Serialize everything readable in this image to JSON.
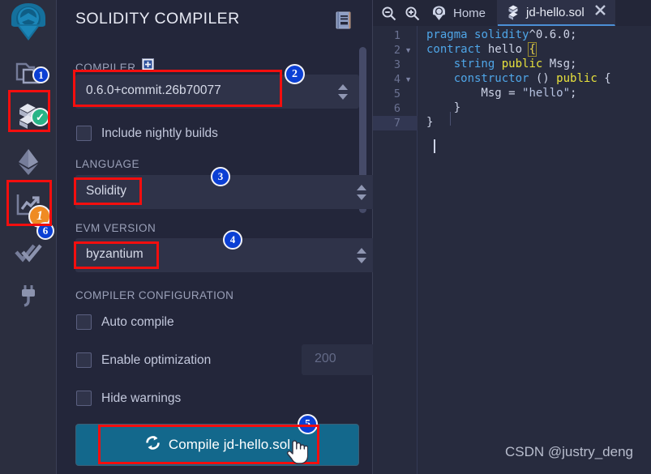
{
  "sidebar": {
    "logo": {
      "name": "remix-logo"
    },
    "items": [
      {
        "name": "file-explorers-icon",
        "badge": "1",
        "badge_style": "blue",
        "highlighted": false
      },
      {
        "name": "solidity-compiler-icon",
        "badge": "✓",
        "badge_style": "green",
        "highlighted": true
      },
      {
        "name": "deploy-run-transactions-icon",
        "badge": "",
        "badge_style": "",
        "highlighted": false
      },
      {
        "name": "solidity-analyzers-icon",
        "badge": "1",
        "badge_style": "orange",
        "badge2": "6",
        "badge2_style": "blue",
        "highlighted": true
      },
      {
        "name": "testing-icon",
        "badge": "",
        "badge_style": "",
        "highlighted": false
      },
      {
        "name": "plugin-manager-icon",
        "badge": "",
        "badge_style": "",
        "highlighted": false
      }
    ]
  },
  "compiler_panel": {
    "title": "SOLIDITY COMPILER",
    "menu_icon": "document-list-icon",
    "compiler_label": "COMPILER",
    "compiler_plus_icon": "plus-box-icon",
    "compiler_version": "0.6.0+commit.26b70077",
    "nightly_checkbox": {
      "label": "Include nightly builds",
      "checked": false
    },
    "language_label": "LANGUAGE",
    "language_value": "Solidity",
    "evm_label": "EVM VERSION",
    "evm_value": "byzantium",
    "config_header": "COMPILER CONFIGURATION",
    "auto_compile": {
      "label": "Auto compile",
      "checked": false
    },
    "enable_optimization": {
      "label": "Enable optimization",
      "checked": false
    },
    "runs_value": "200",
    "hide_warnings": {
      "label": "Hide warnings",
      "checked": false
    },
    "compile_button": {
      "label": "Compile jd-hello.sol",
      "icon": "refresh-icon"
    }
  },
  "editor": {
    "zoom_out_icon": "zoom-out-icon",
    "zoom_in_icon": "zoom-in-icon",
    "home_tab": {
      "label": "Home",
      "icon": "remix-home-icon"
    },
    "file_tab": {
      "label": "jd-hello.sol",
      "icon": "solidity-file-icon",
      "close_icon": "close-icon"
    },
    "line_numbers": [
      "1",
      "2",
      "3",
      "4",
      "5",
      "6",
      "7"
    ],
    "active_line": "7",
    "fold_markers": [
      "2",
      "4"
    ],
    "code": [
      "pragma solidity^0.6.0;",
      "contract hello {",
      "    string public Msg;",
      "    constructor () public {",
      "        Msg = \"hello\";",
      "    }",
      "}"
    ]
  },
  "annotations": {
    "markers": [
      {
        "id": "1",
        "style": "blue"
      },
      {
        "id": "2",
        "style": "blue"
      },
      {
        "id": "3",
        "style": "blue"
      },
      {
        "id": "4",
        "style": "blue"
      },
      {
        "id": "5",
        "style": "blue"
      },
      {
        "id": "6",
        "style": "blue"
      }
    ],
    "highlight_color": "#f40e0e"
  },
  "watermark": "CSDN @justry_deng",
  "colors": {
    "panel_bg": "#23263a",
    "sidebar_bg": "#2b2e3f",
    "editor_bg": "#272b3e",
    "accent_blue": "#13688c",
    "highlight_red": "#f40e0e",
    "marker_blue": "#0b3fd4",
    "badge_green": "#28b487",
    "badge_orange": "#ef8b23"
  }
}
